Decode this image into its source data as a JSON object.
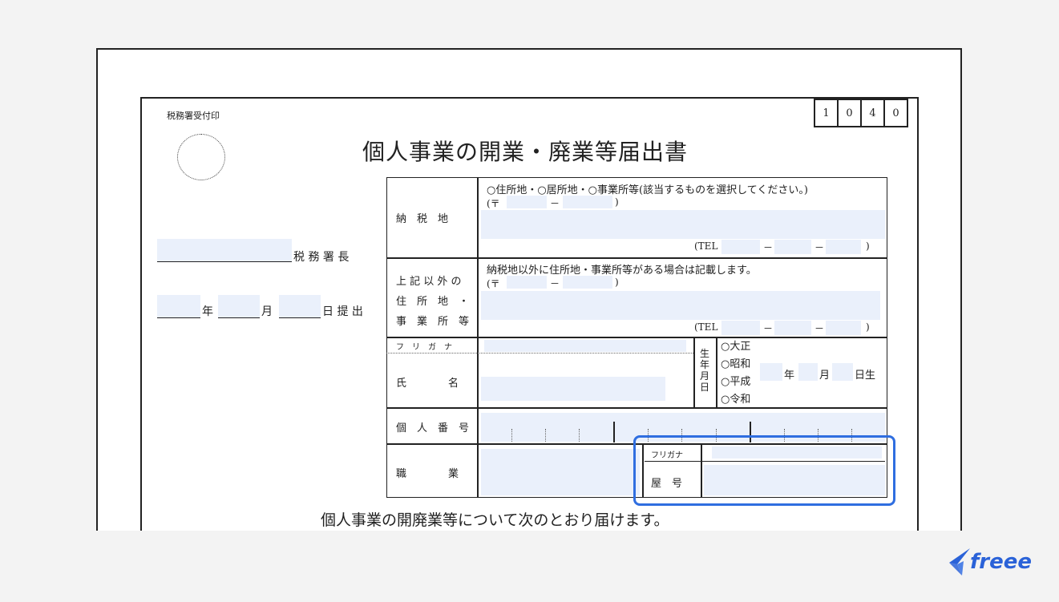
{
  "form": {
    "stamp_label": "税務署受付印",
    "form_number": [
      "1",
      "0",
      "4",
      "0"
    ],
    "title": "個人事業の開業・廃業等届出書",
    "tax_office_suffix": "税 務 署 長",
    "date_year": "年",
    "date_month": "月",
    "date_day_submit": "日 提 出",
    "footer_text": "個人事業の開廃業等について次のとおり届けます。"
  },
  "rows": {
    "nozeichi": {
      "label": "納　税　地",
      "options": "○住所地・○居所地・○事業所等(該当するものを選択してください。)",
      "postal_open": "(〒",
      "postal_dash": "－",
      "postal_close": ")",
      "tel_open": "(TEL",
      "tel_dash1": "－",
      "tel_dash2": "－",
      "tel_close": ")"
    },
    "other_address": {
      "label_1": "上 記 以 外 の",
      "label_2": "住　所　地　・",
      "label_3": "事　業　所　等",
      "note": "納税地以外に住所地・事業所等がある場合は記載します。",
      "postal_open": "(〒",
      "postal_dash": "－",
      "postal_close": ")",
      "tel_open": "(TEL",
      "tel_dash1": "－",
      "tel_dash2": "－",
      "tel_close": ")"
    },
    "name": {
      "furigana_label": "フ　リ　ガ　ナ",
      "label": "氏　　　　名",
      "birth_label": [
        "生",
        "年",
        "月",
        "日"
      ],
      "eras": [
        "○大正",
        "○昭和",
        "○平成",
        "○令和"
      ],
      "year": "年",
      "month": "月",
      "day": "日生"
    },
    "my_number": {
      "label": "個　人　番　号"
    },
    "occupation": {
      "label": "職　　　　業",
      "shop_furigana_label": "フリガナ",
      "shop_label": "屋　号"
    }
  },
  "brand": {
    "logo_text": "freee",
    "logo_color": "#2a62d8",
    "highlight_color": "#2f6ee0"
  }
}
